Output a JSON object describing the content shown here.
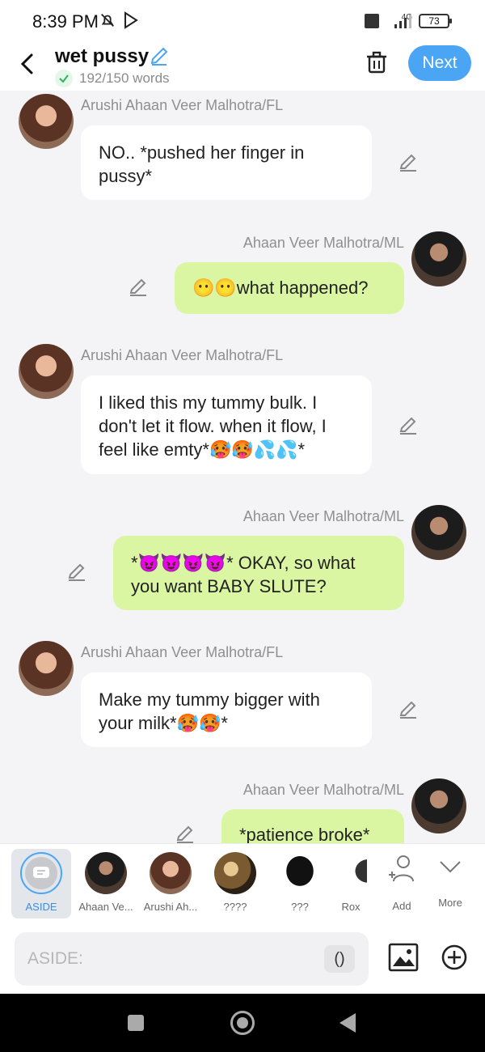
{
  "status_bar": {
    "time": "8:39 PM",
    "network": "4G",
    "battery": "73"
  },
  "header": {
    "title": "wet pussy",
    "word_count": "192/150 words",
    "next_label": "Next"
  },
  "messages": [
    {
      "sender": "Arushi Ahaan Veer Malhotra/FL",
      "text": "NO.. *pushed her finger in pussy*"
    },
    {
      "sender": "Ahaan Veer Malhotra/ML",
      "text": "😶😶what happened?"
    },
    {
      "sender": "Arushi Ahaan Veer Malhotra/FL",
      "text": "I liked this my tummy bulk. I don't let it flow. when it flow, I feel like emty*🥵🥵💦💦*"
    },
    {
      "sender": "Ahaan Veer Malhotra/ML",
      "text": "*😈😈😈😈* OKAY, so what you want BABY SLUTE?"
    },
    {
      "sender": "Arushi Ahaan Veer Malhotra/FL",
      "text": "Make my tummy bigger with your milk*🥵🥵*"
    },
    {
      "sender": "Ahaan Veer Malhotra/ML",
      "text": "*patience broke*"
    }
  ],
  "characters": [
    {
      "label": "ASIDE"
    },
    {
      "label": "Ahaan Ve..."
    },
    {
      "label": "Arushi Ah..."
    },
    {
      "label": "????"
    },
    {
      "label": "???"
    },
    {
      "label": "Rox"
    },
    {
      "label": "Add"
    },
    {
      "label": "More"
    }
  ],
  "input": {
    "placeholder": "ASIDE:",
    "paren_label": "()"
  },
  "colors": {
    "accent": "#4aa5f5",
    "user_bubble": "#dbf6a3",
    "other_bubble": "#ffffff",
    "background": "#f4f4f6"
  },
  "icons": [
    "bell-off-icon",
    "play-store-icon",
    "back-arrow-icon",
    "pencil-icon",
    "check-icon",
    "trash-icon",
    "image-icon",
    "plus-circle-icon",
    "add-person-icon",
    "chevron-down-icon"
  ]
}
